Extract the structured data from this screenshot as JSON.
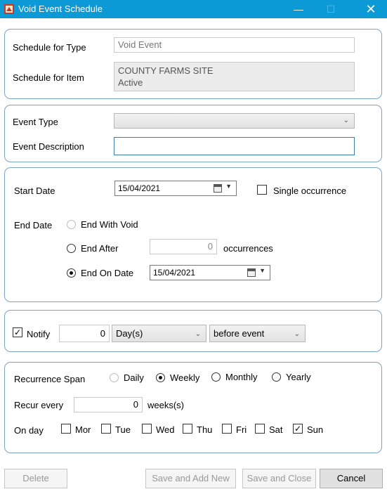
{
  "window": {
    "title": "Void Event Schedule",
    "min_glyph": "—",
    "max_glyph": "☐",
    "close_glyph": "✕"
  },
  "schedule": {
    "type_label": "Schedule for Type",
    "type_value": "Void Event",
    "item_label": "Schedule for Item",
    "item_line1": "COUNTY FARMS SITE",
    "item_line2": "Active"
  },
  "event": {
    "type_label": "Event Type",
    "type_value": "",
    "description_label": "Event Description",
    "description_value": ""
  },
  "dates": {
    "start_label": "Start Date",
    "start_value": "15/04/2021",
    "single_occurrence_label": "Single occurrence",
    "single_occurrence_checked": false,
    "end_label": "End Date",
    "end_with_void_label": "End With Void",
    "end_after_label": "End After",
    "occurrences_value": "0",
    "occurrences_label": "occurrences",
    "end_on_date_label": "End On Date",
    "end_on_date_value": "15/04/2021",
    "selected": "end_on_date"
  },
  "notify": {
    "label": "Notify",
    "checked": true,
    "amount": "0",
    "unit": "Day(s)",
    "relation": "before event"
  },
  "recurrence": {
    "span_label": "Recurrence Span",
    "options": [
      "Daily",
      "Weekly",
      "Monthly",
      "Yearly"
    ],
    "selected": "Weekly",
    "recur_every_label": "Recur every",
    "recur_every_value": "0",
    "recur_unit_label": "weeks(s)",
    "on_day_label": "On day",
    "days": [
      {
        "label": "Mor",
        "checked": false
      },
      {
        "label": "Tue",
        "checked": false
      },
      {
        "label": "Wed",
        "checked": false
      },
      {
        "label": "Thu",
        "checked": false
      },
      {
        "label": "Fri",
        "checked": false
      },
      {
        "label": "Sat",
        "checked": false
      },
      {
        "label": "Sun",
        "checked": true
      }
    ]
  },
  "buttons": {
    "delete": "Delete",
    "save_add_new": "Save and Add New",
    "save_close": "Save and Close",
    "cancel": "Cancel"
  },
  "colors": {
    "titlebar": "#0c9ad6",
    "group_border": "#7aa3c8"
  },
  "icons": {
    "app": "app-icon",
    "calendar": "calendar-icon",
    "dropdown": "chevron-down-icon",
    "check": "check-icon"
  }
}
